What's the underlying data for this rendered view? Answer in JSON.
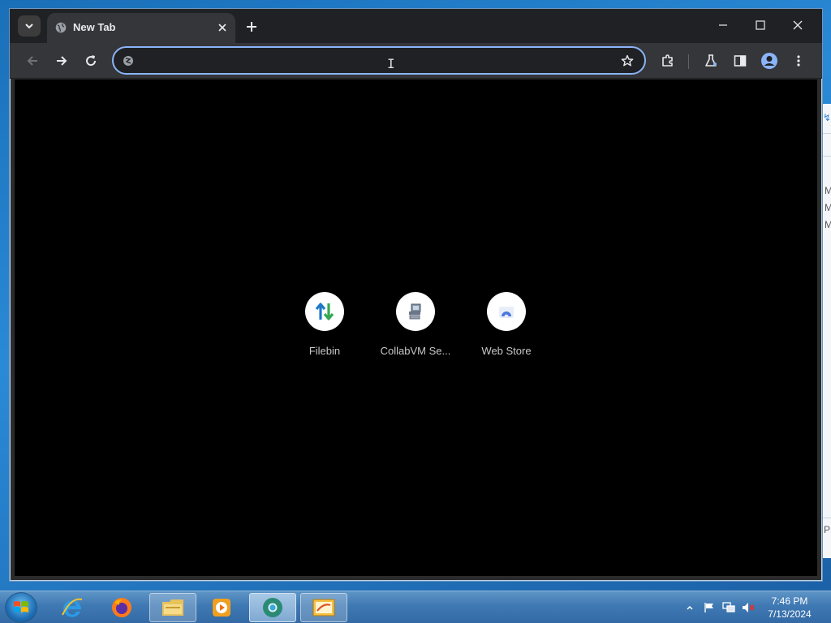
{
  "window": {
    "tab_title": "New Tab",
    "omnibox_value": ""
  },
  "shortcuts": [
    {
      "label": "Filebin",
      "icon": "up-down-arrows-icon"
    },
    {
      "label": "CollabVM Se...",
      "icon": "computer-icon"
    },
    {
      "label": "Web Store",
      "icon": "web-store-icon"
    }
  ],
  "background_window": {
    "glyph": "↯",
    "lines": [
      "M",
      "M",
      "M",
      "PI"
    ]
  },
  "taskbar": {
    "apps": [
      "internet-explorer",
      "firefox",
      "file-explorer",
      "media-player",
      "chrome",
      "paint"
    ],
    "clock_time": "7:46 PM",
    "clock_date": "7/13/2024"
  },
  "colors": {
    "accent": "#8ab4f8",
    "tab_bg": "#35363a",
    "strip_bg": "#202124",
    "content_bg": "#000000"
  }
}
